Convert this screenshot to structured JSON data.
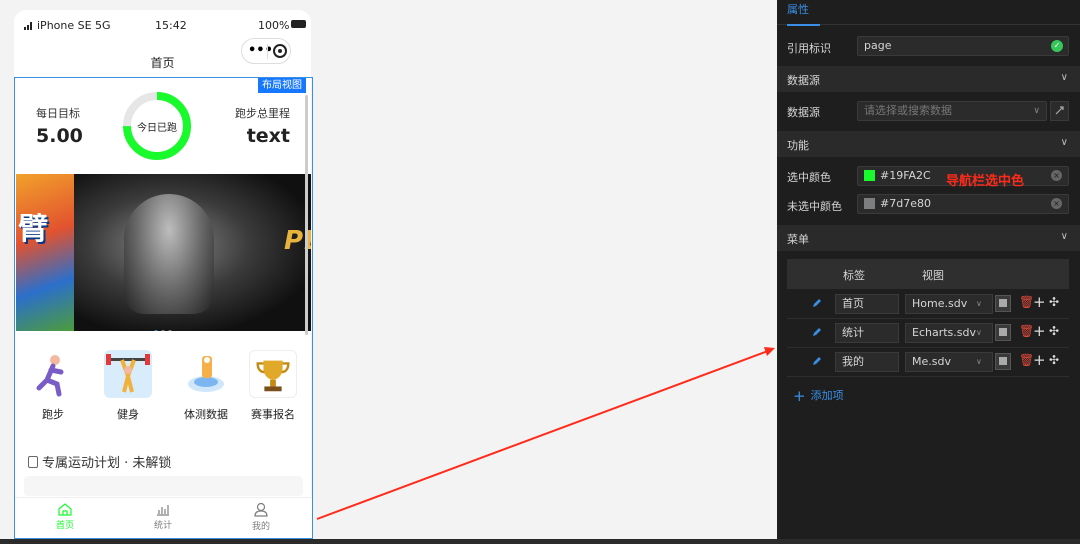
{
  "phone": {
    "status": {
      "carrier": "iPhone SE 5G",
      "time": "15:42",
      "battery": "100%"
    },
    "nav_title": "首页",
    "layout_badge": "布局视图",
    "stats": {
      "left_label": "每日目标",
      "left_value": "5.00",
      "ring_label": "今日已跑",
      "right_label": "跑步总里程",
      "right_value": "text"
    },
    "grid": [
      {
        "label": "跑步",
        "icon": "runner-icon"
      },
      {
        "label": "健身",
        "icon": "weightlifting-icon"
      },
      {
        "label": "体测数据",
        "icon": "body-test-icon"
      },
      {
        "label": "赛事报名",
        "icon": "trophy-icon"
      }
    ],
    "plan_title": "专属运动计划 · 未解锁",
    "tabs": [
      {
        "label": "首页",
        "icon": "home-icon"
      },
      {
        "label": "统计",
        "icon": "chart-icon"
      },
      {
        "label": "我的",
        "icon": "user-icon"
      }
    ]
  },
  "panel": {
    "tab_label": "属性",
    "ref_label": "引用标识",
    "ref_value": "page",
    "section_datasource": "数据源",
    "datasource_label": "数据源",
    "datasource_placeholder": "请选择或搜索数据",
    "section_function": "功能",
    "selected_color_label": "选中颜色",
    "selected_color": "#19FA2C",
    "unselected_color_label": "未选中颜色",
    "unselected_color": "#7d7e80",
    "annotation": "导航栏选中色",
    "section_menu": "菜单",
    "menu_headers": {
      "label": "标签",
      "view": "视图"
    },
    "menu_rows": [
      {
        "label": "首页",
        "view": "Home.sdv"
      },
      {
        "label": "统计",
        "view": "Echarts.sdv"
      },
      {
        "label": "我的",
        "view": "Me.sdv"
      }
    ],
    "add_item": "添加项"
  },
  "colors": {
    "accent": "#19FA2C",
    "inactive": "#7d7e80",
    "link": "#3a8ee6",
    "annotation": "#ff2a1a"
  }
}
